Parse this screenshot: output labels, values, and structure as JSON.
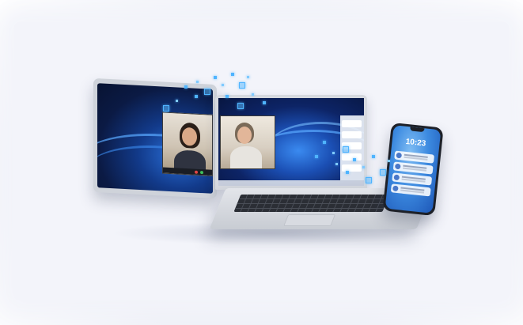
{
  "scene": {
    "title": "",
    "phone": {
      "lock_time": "10:23"
    },
    "colors": {
      "accent": "#4fb4ff",
      "screen_dark": "#0b1a44",
      "screen_blue": "#2a6fd8",
      "device_silver": "#d6d9df"
    },
    "icons": [
      "video-call-window",
      "notification-panel",
      "data-transfer-particles"
    ]
  }
}
